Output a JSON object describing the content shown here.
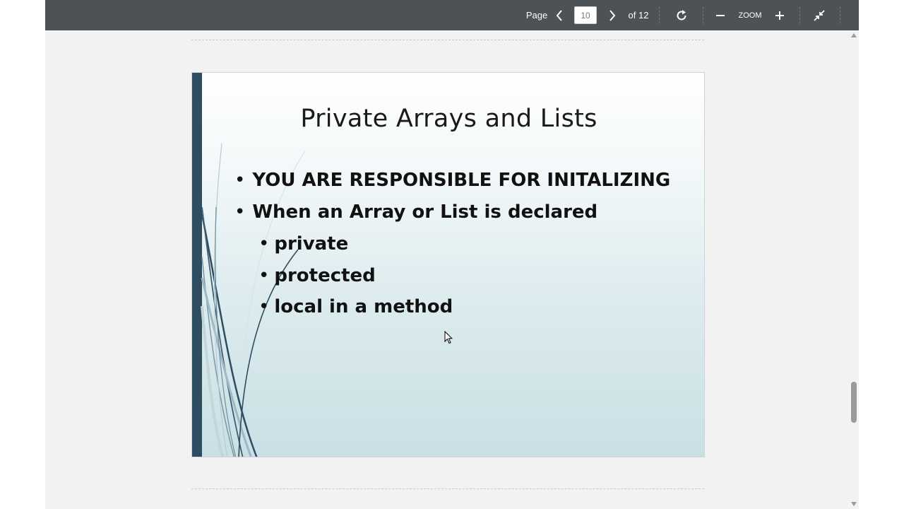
{
  "toolbar": {
    "page_label": "Page",
    "current_page": "10",
    "page_count_label": "of 12",
    "zoom_label": "ZOOM",
    "icons": {
      "prev": "chevron-left-icon",
      "next": "chevron-right-icon",
      "rotate": "rotate-icon",
      "zoom_out": "minus-icon",
      "zoom_in": "plus-icon",
      "collapse": "collapse-icon"
    }
  },
  "slide": {
    "title": "Private Arrays and Lists",
    "bullets": [
      {
        "text": "YOU ARE RESPONSIBLE FOR INITALIZING",
        "level": 1
      },
      {
        "text": "When an Array or List is declared",
        "level": 1
      },
      {
        "text": "private",
        "level": 2
      },
      {
        "text": "protected",
        "level": 2
      },
      {
        "text": "local in a method",
        "level": 2
      }
    ],
    "bullet_glyph": "•",
    "colors": {
      "accent_bar": "#2f4d60",
      "gradient_top": "#ffffff",
      "gradient_bottom": "#c9e0e4"
    }
  },
  "colors": {
    "toolbar_bg": "#4d5257",
    "viewer_bg": "#f2f2f2"
  }
}
